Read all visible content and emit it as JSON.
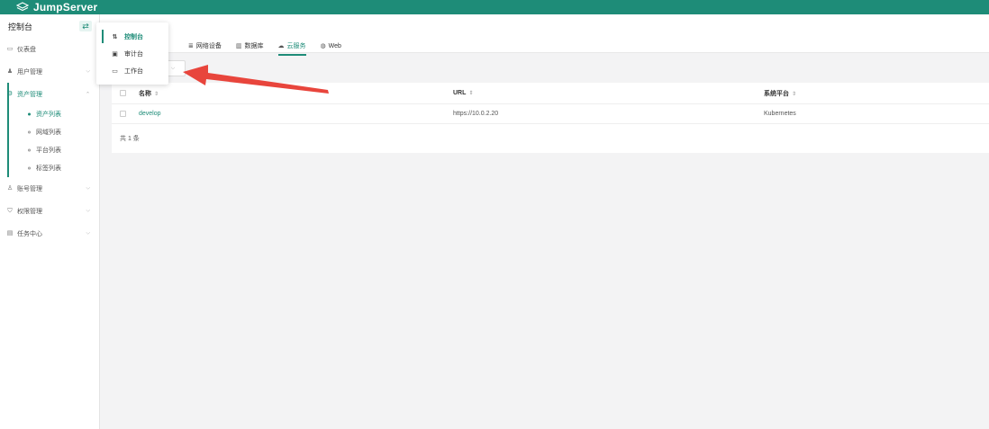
{
  "brand": {
    "name": "JumpServer"
  },
  "sidebar": {
    "title": "控制台",
    "items": [
      {
        "label": "仪表盘",
        "icon": "dashboard-icon"
      },
      {
        "label": "用户管理",
        "icon": "users-icon"
      },
      {
        "label": "资产管理",
        "icon": "assets-icon"
      },
      {
        "label": "账号管理",
        "icon": "accounts-icon"
      },
      {
        "label": "权限管理",
        "icon": "permission-icon"
      },
      {
        "label": "任务中心",
        "icon": "tasks-icon"
      }
    ],
    "asset_submenu": [
      "资产列表",
      "网域列表",
      "平台列表",
      "标签列表"
    ]
  },
  "tabs": [
    {
      "label": "网络设备",
      "icon": "network-icon"
    },
    {
      "label": "数据库",
      "icon": "database-icon"
    },
    {
      "label": "云服务",
      "icon": "cloud-icon"
    },
    {
      "label": "Web",
      "icon": "globe-icon"
    }
  ],
  "table": {
    "headers": {
      "name": "名称",
      "url": "URL",
      "platform": "系统平台"
    },
    "rows": [
      {
        "name": "develop",
        "url": "https://10.0.2.20",
        "platform": "Kubernetes"
      }
    ],
    "total": "共 1 条"
  },
  "dropdown": {
    "items": [
      {
        "label": "控制台",
        "icon": "console-icon"
      },
      {
        "label": "审计台",
        "icon": "audit-icon"
      },
      {
        "label": "工作台",
        "icon": "workbench-icon"
      }
    ]
  },
  "colors": {
    "primary": "#1e8c78",
    "annotation_arrow": "#e8453c"
  }
}
